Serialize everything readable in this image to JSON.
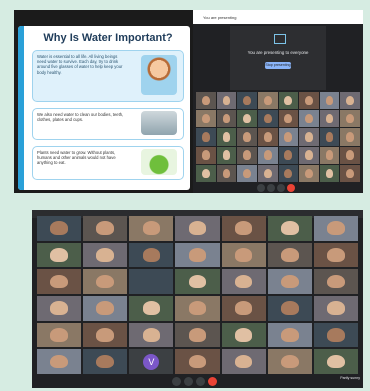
{
  "slide": {
    "title": "Why Is Water Important?",
    "box1": "Water is essential to all life. All living beings need water to survive. Each day, try to drink around five glasses of water to help keep your body healthy.",
    "box2": "We also need water to clean our bodies, teeth, clothes, plates and cups.",
    "box3": "Plants need water to grow. Without plants, humans and other animals would not have anything to eat."
  },
  "meet1": {
    "header_left": "You are presenting",
    "present_text": "You are presenting to everyone",
    "present_button": "Stop presenting"
  },
  "meet2": {
    "avatar_letter": "V",
    "weather": "Partly sunny"
  }
}
